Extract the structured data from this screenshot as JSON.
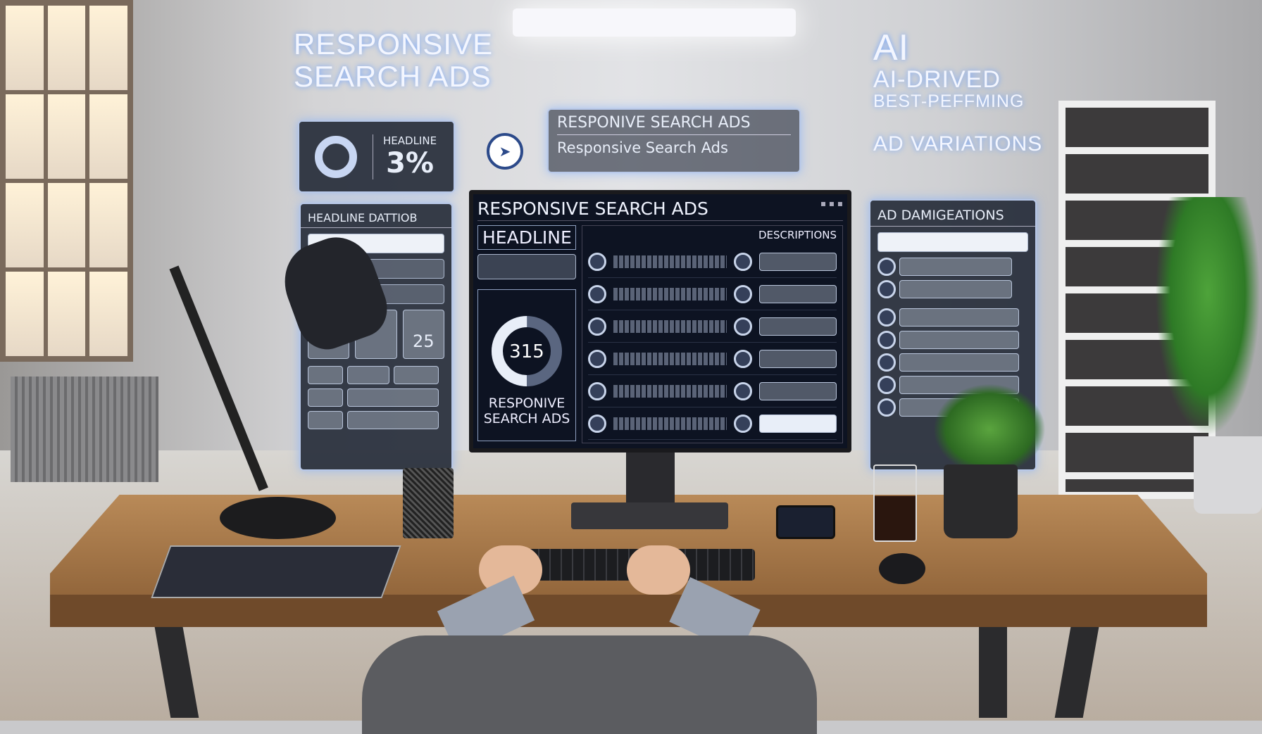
{
  "left_overlay": {
    "title_line1": "RESPONSIVE",
    "title_line2": "SEARCH ADS",
    "stat_card": {
      "label": "HEADLINE",
      "value": "3%"
    },
    "panel_title": "HEADLINE DATTIOB",
    "metric_values": [
      "",
      "",
      "25"
    ]
  },
  "center_overlay": {
    "line1": "RESPONIVE SEARCH ADS",
    "line2": "Responsive Search Ads"
  },
  "monitor": {
    "title": "RESPONSIVE SEARCH ADS",
    "headline_label": "HEADLINE",
    "descriptions_label": "DESCRIPTIONS",
    "donut_value": "315",
    "donut_fill_percent": 50,
    "bottom_label_line1": "RESPONIVE",
    "bottom_label_line2": "SEARCH ADS"
  },
  "right_overlay": {
    "title_ai": "AI",
    "title_line1": "AI-DRIVED",
    "title_line2": "BEST-PEFFMING",
    "title_line3": "AD VARIATIONS",
    "panel_title": "AD DAMIGEATIONS"
  },
  "colors": {
    "holo_glow": "#6aa0ff",
    "panel_bg": "#1e2432",
    "accent": "#b8c8e8"
  }
}
